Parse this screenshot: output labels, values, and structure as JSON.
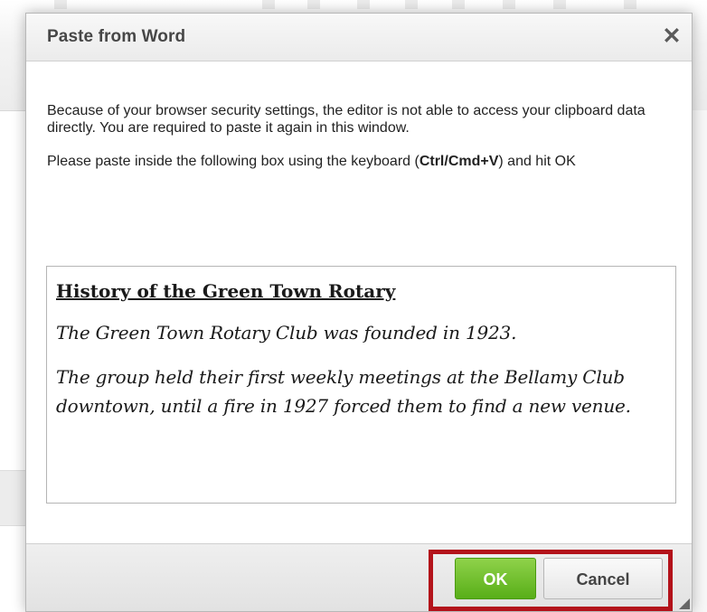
{
  "dialog": {
    "title": "Paste from Word",
    "close_icon": "close-icon",
    "intro_text": "Because of your browser security settings, the editor is not able to access your clipboard data directly. You are required to paste it again in this window.",
    "instruction_prefix": "Please paste inside the following box using the keyboard (",
    "instruction_shortcut": "Ctrl/Cmd+V",
    "instruction_suffix": ") and hit OK",
    "paste_area": {
      "heading": "History of the Green Town Rotary",
      "paragraphs": [
        "The Green Town Rotary Club was founded in 1923.",
        "The group held their first weekly meetings at the Bellamy Club downtown, until a fire in 1927 forced them to find a new venue."
      ]
    },
    "buttons": {
      "ok_label": "OK",
      "cancel_label": "Cancel"
    }
  },
  "colors": {
    "ok_green": "#6cbf2a",
    "highlight_red": "#b3121a",
    "title_text": "#474747"
  }
}
